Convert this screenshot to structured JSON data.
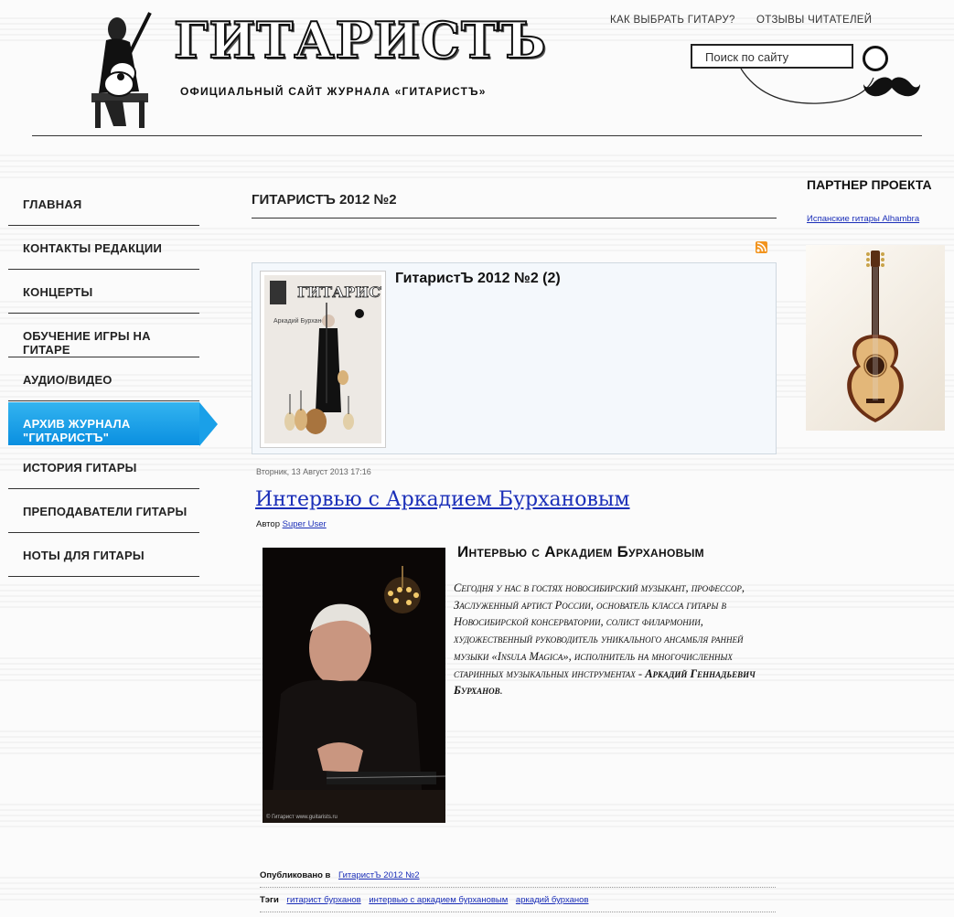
{
  "header": {
    "logo_title": "ГИТАРИСТЪ",
    "subtitle": "ОФИЦИАЛЬНЫЙ САЙТ ЖУРНАЛА «ГИТАРИСТЪ»",
    "toplinks": [
      "Как выбрать гитару?",
      "Отзывы читателей"
    ],
    "search_placeholder": "Поиск по сайту"
  },
  "nav": {
    "items": [
      {
        "label": "Главная"
      },
      {
        "label": "Контакты редакции"
      },
      {
        "label": "Концерты"
      },
      {
        "label": "Обучение игры на гитаре"
      },
      {
        "label": "Аудио/Видео"
      },
      {
        "label": "Архив журнала \"ГитаристЪ\""
      },
      {
        "label": "История гитары"
      },
      {
        "label": "Преподаватели гитары"
      },
      {
        "label": "Ноты для гитары"
      }
    ],
    "active_index": 5
  },
  "main": {
    "page_heading": "ГитаристЪ 2012 №2",
    "category": {
      "title": "ГитаристЪ 2012 №2 (2)",
      "cover_caption": "Аркадий Бурханов"
    },
    "article": {
      "date": "Вторник, 13 Август 2013 17:16",
      "title": "Интервью с Аркадием Бурхановым",
      "author_prefix": "Автор",
      "author": "Super User",
      "inner_title": "Интервью с Аркадием Бурхановым",
      "intro_text": "Сегодня у нас в гостях новосибирский музыкант, профессор, Заслуженный артист России, основатель класса гитары в Новосибирской консерватории, солист филармонии, художественный руководитель уникального ансамбля ранней музыки «Insula Magica», исполнитель на многочисленных старинных музыкальных инструментах - ",
      "intro_bold": "Аркадий Геннадьевич Бурханов",
      "intro_end": ".",
      "photo_caption": "© Гитарист www.guitarists.ru",
      "published_label": "Опубликовано в",
      "published_link": "ГитаристЪ 2012 №2",
      "tags_label": "Тэги",
      "tags": [
        "гитарист бурханов",
        "интервью с аркадием бурхановым",
        "аркадий бурханов"
      ]
    }
  },
  "sidebar_right": {
    "title": "Партнер проекта",
    "link": "Испанские гитары Alhambra"
  },
  "colors": {
    "nav_active": "#1aa0e8",
    "link": "#1a2eb8",
    "rss": "#f2941e"
  }
}
